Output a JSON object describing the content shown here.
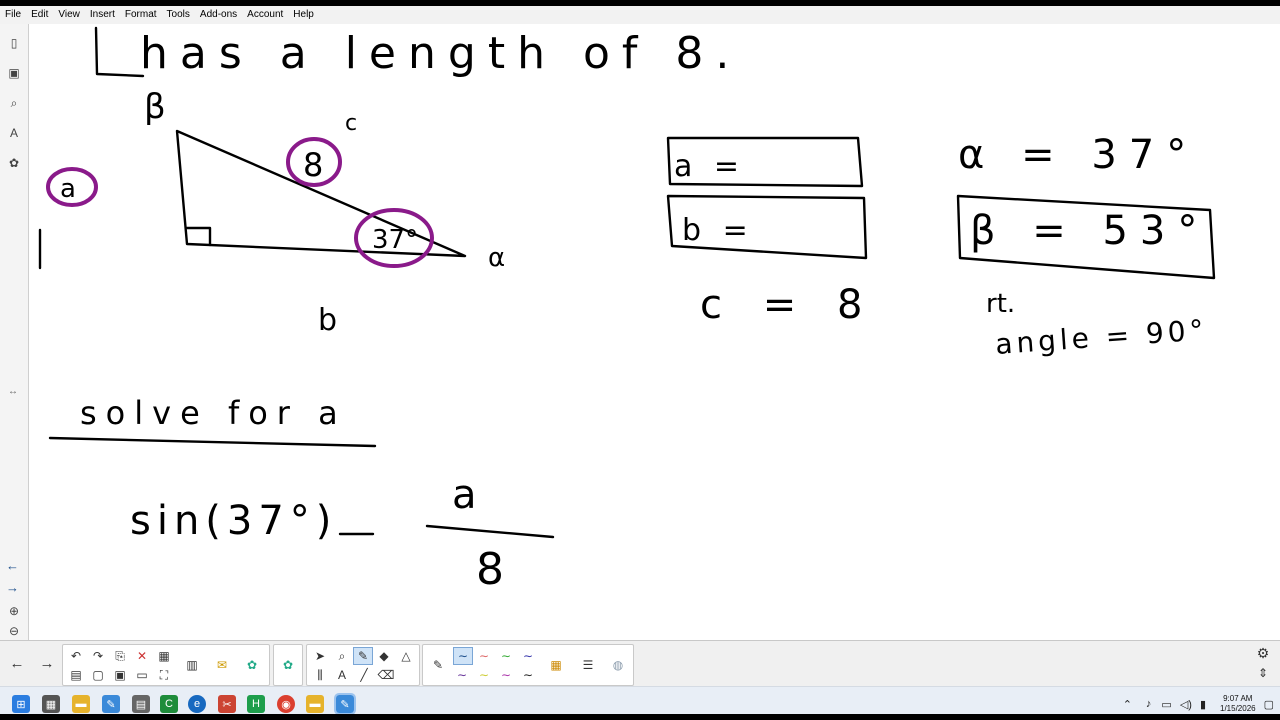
{
  "menu": [
    "File",
    "Edit",
    "View",
    "Insert",
    "Format",
    "Tools",
    "Add-ons",
    "Account",
    "Help"
  ],
  "board": {
    "title_text": "has a length of 8.",
    "vertex_beta": "β",
    "side_c": "c",
    "side_a": "a",
    "side_b": "b",
    "vertex_alpha": "α",
    "circled_hyp": "8",
    "circled_angle": "37°",
    "box_a": "a =",
    "box_b": "b =",
    "c_eq": "c = 8",
    "alpha_eq": "α = 37°",
    "beta_eq": "β = 53°",
    "rt_label": "rt.",
    "rt_angle": "angle = 90°",
    "solve_heading": "solve for a",
    "eq_lhs": "sin(37°)",
    "eq_sign": "=",
    "eq_num": "a",
    "eq_den": "8"
  },
  "clock": {
    "time": "9:07 AM",
    "date": "1/15/2026"
  },
  "colors": {
    "ink": "#000000",
    "highlight": "#8a1a8a",
    "sidebar_arrow": "#1a4d8a"
  }
}
